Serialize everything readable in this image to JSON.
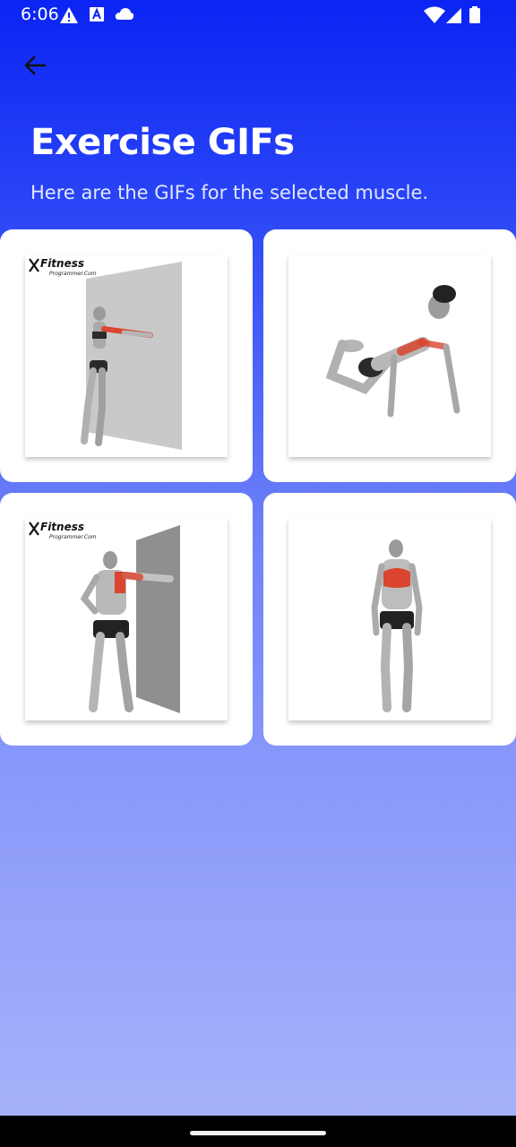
{
  "status_bar": {
    "time": "6:06",
    "left_icons": [
      "warning-icon",
      "font-icon",
      "cloud-icon"
    ],
    "right_icons": [
      "wifi-icon",
      "signal-icon",
      "battery-icon"
    ]
  },
  "header": {
    "back_icon": "arrow-back-icon",
    "title": "Exercise GIFs",
    "subtitle": "Here are the GIFs for the selected muscle."
  },
  "gifs": [
    {
      "logo": "Fitness",
      "logo_sub": "Programmer.Com",
      "description": "woman doing wall chest stretch"
    },
    {
      "logo": "",
      "logo_sub": "",
      "description": "woman doing knee push-up"
    },
    {
      "logo": "Fitness",
      "logo_sub": "Programmer.Com",
      "description": "man doing wall chest stretch"
    },
    {
      "logo": "",
      "logo_sub": "",
      "description": "man standing with chest highlighted"
    }
  ],
  "colors": {
    "accent": "#0b24f4",
    "muscle_highlight": "#d9452e"
  }
}
